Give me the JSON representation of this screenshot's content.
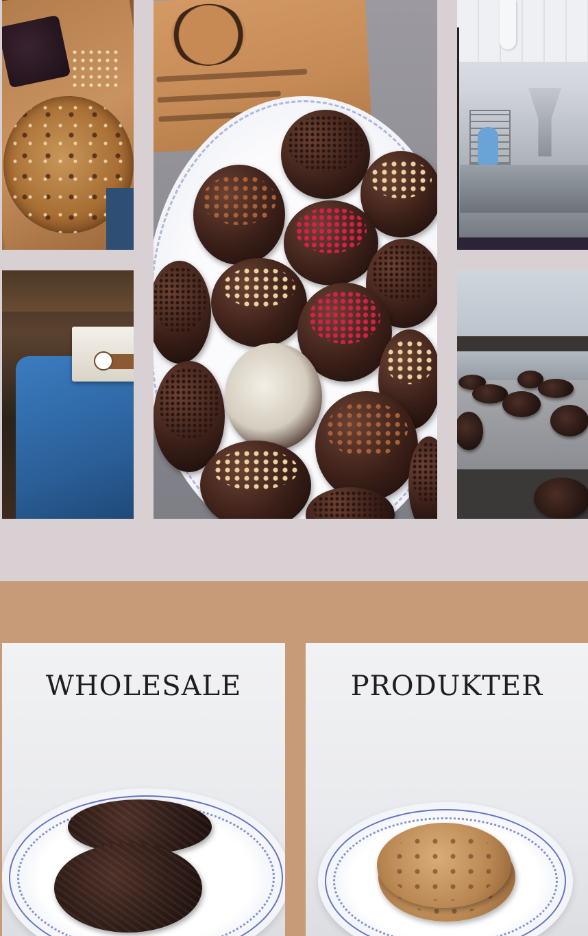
{
  "gallery": {
    "photos": [
      {
        "icon": "cookie-photo"
      },
      {
        "icon": "rum-ball-photo"
      },
      {
        "icon": "factory-photo"
      },
      {
        "icon": "gift-box-photo"
      },
      {
        "icon": "baking-tray-photo"
      }
    ]
  },
  "colors": {
    "page_background": "#d8d0d3",
    "band_background": "#c79b78",
    "card_title": "#1e1e1e"
  },
  "cards": {
    "wholesale": {
      "title": "Wholesale"
    },
    "produkter": {
      "title": "Produkter"
    }
  }
}
